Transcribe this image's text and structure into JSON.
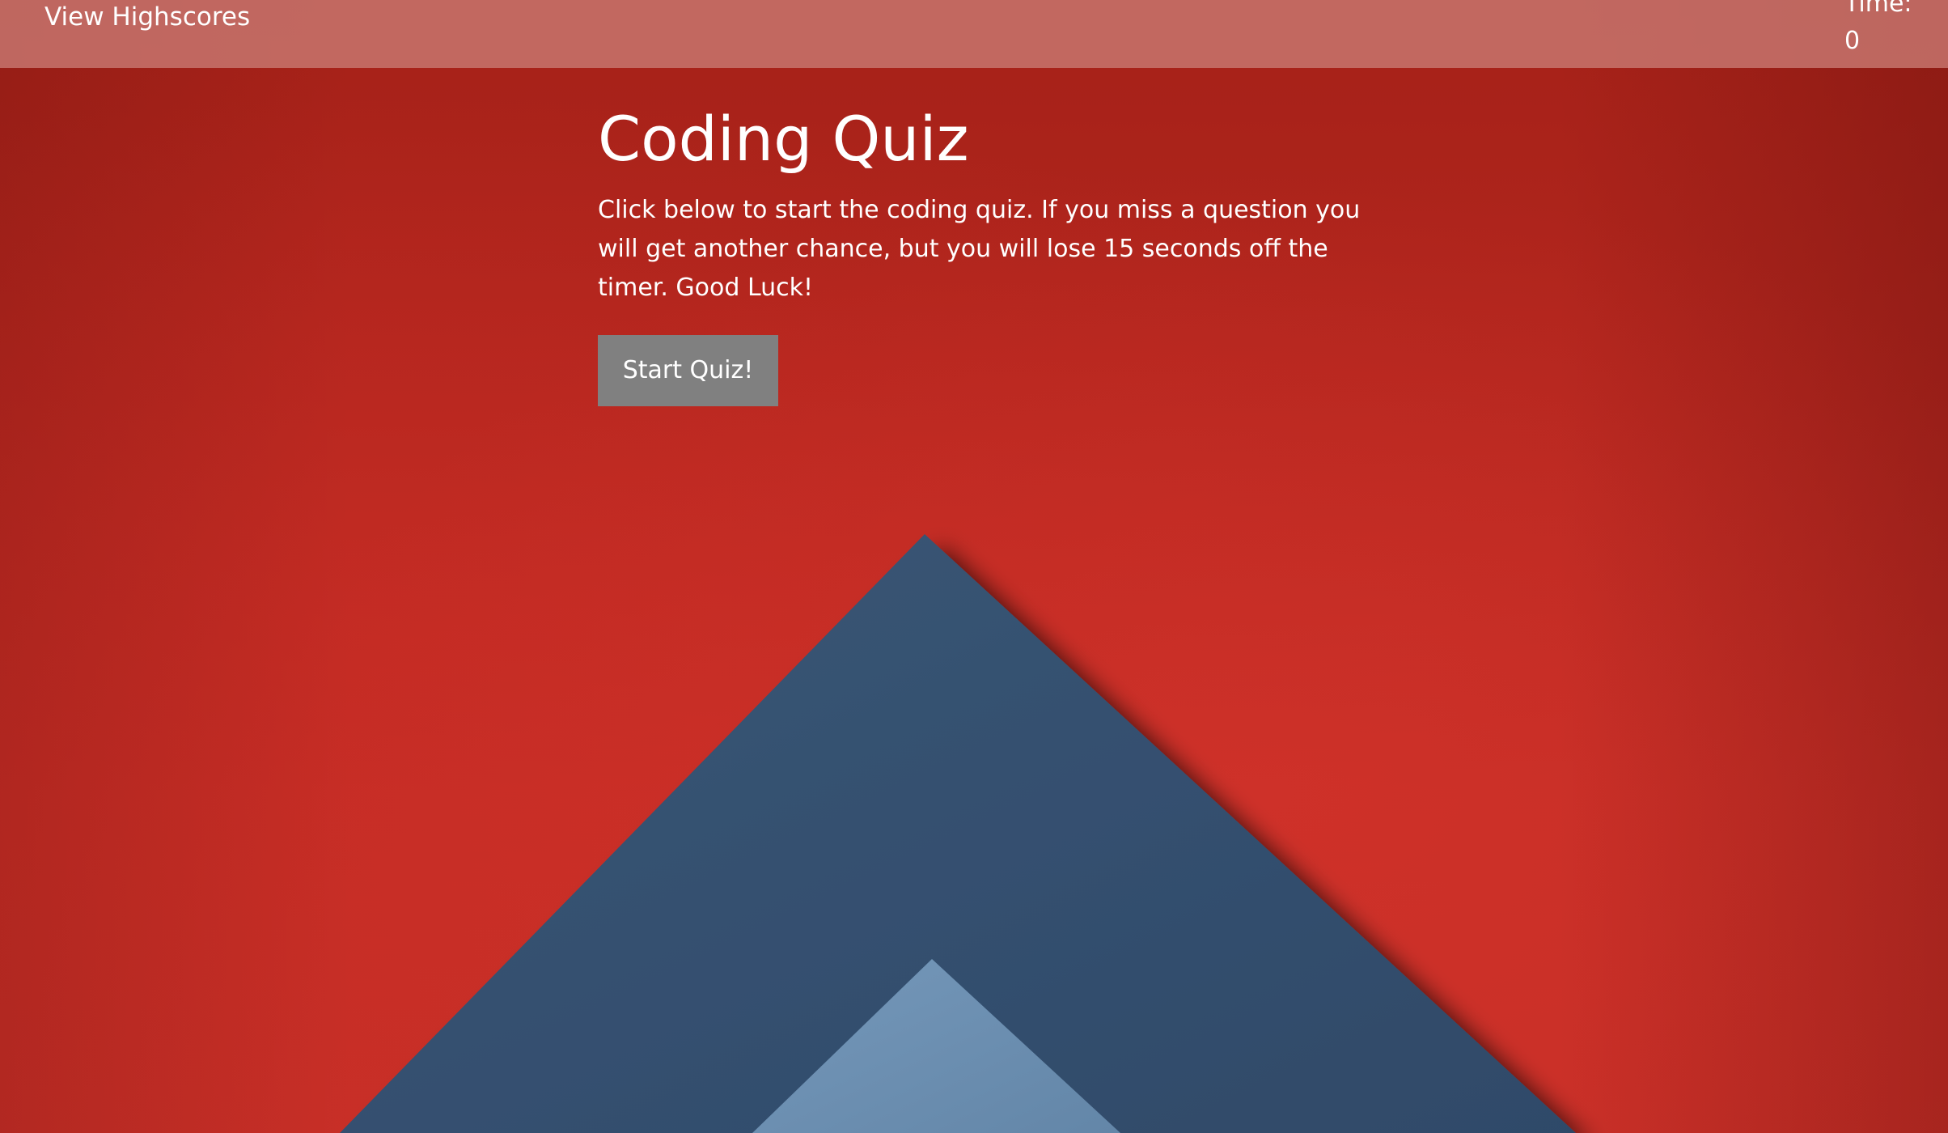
{
  "header": {
    "highscores_label": "View Highscores",
    "timer_label": "Time:",
    "timer_value": "0"
  },
  "main": {
    "title": "Coding Quiz",
    "intro": "Click below to start the coding quiz. If you miss a question you will get another chance, but you will lose 15 seconds off the timer. Good Luck!",
    "start_button_label": "Start Quiz!"
  },
  "colors": {
    "background_red": "#b42720",
    "navy_paper": "#34506f",
    "light_blue_paper": "#6b8eb0",
    "topbar": "#c47a70",
    "button": "#808080",
    "text": "#ffffff"
  }
}
